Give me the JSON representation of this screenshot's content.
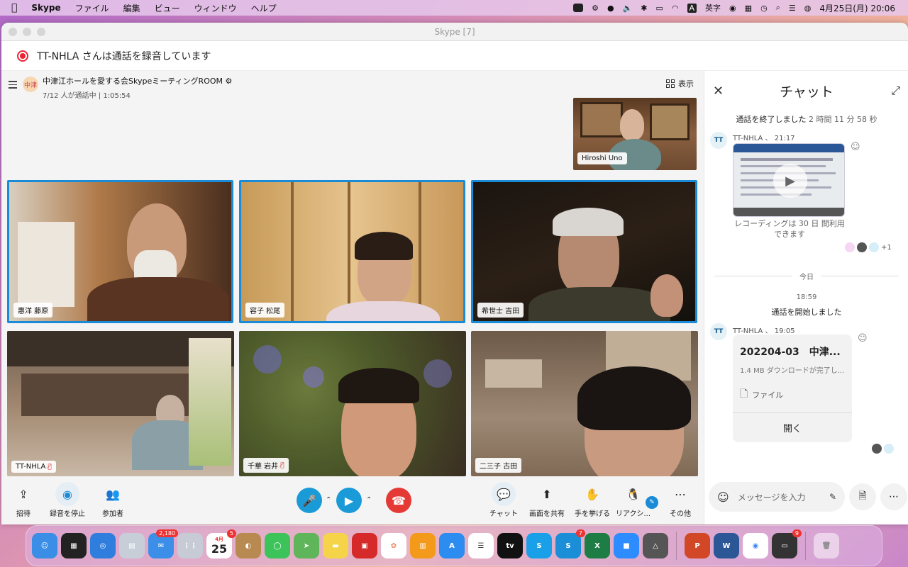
{
  "menubar": {
    "app_name": "Skype",
    "menus": [
      "ファイル",
      "編集",
      "ビュー",
      "ウィンドウ",
      "ヘルプ"
    ],
    "input_mode": "英字",
    "datetime": "4月25日(月)  20:06"
  },
  "window": {
    "title": "Skype [7]",
    "recording_banner": "TT-NHLA さんは通話を録音しています"
  },
  "call": {
    "avatar_text": "中津",
    "title": "中津江ホールを愛する会SkypeミーティングROOM",
    "subtitle": "7/12 人が通話中 | 1:05:54",
    "view_label": "表示"
  },
  "participants": {
    "self": "Hiroshi Uno",
    "tiles": [
      "惠洋 藤原",
      "容子 松尾",
      "希世士 吉田",
      "TT-NHLA",
      "千華 岩井",
      "二三子 古田"
    ]
  },
  "controls": {
    "invite": "招待",
    "stop_recording": "録音を停止",
    "participants": "参加者",
    "chat": "チャット",
    "share_screen": "画面を共有",
    "raise_hand": "手を挙げる",
    "reactions": "リアクシ...",
    "more": "その他"
  },
  "chat": {
    "header": "チャット",
    "call_ended": "通話を終了しました",
    "call_ended_duration": "2 時間 11 分 58 秒",
    "msg1_meta": "TT-NHLA 、 21:17",
    "avatar_tt": "TT",
    "recording_note": "レコーディングは 30 日 間利用できます",
    "read_more": "+1",
    "today": "今日",
    "time_1859": "18:59",
    "call_started": "通話を開始しました",
    "msg2_meta": "TT-NHLA 、 19:05",
    "file_name": "202204-03　中津...",
    "file_status": "1.4 MB ダウンロードが完了し...",
    "file_type": "ファイル",
    "open": "開く",
    "input_placeholder": "メッセージを入力"
  },
  "dock": {
    "mail_badge": "2,180",
    "calendar_month": "4月",
    "calendar_day": "25",
    "calendar_badge": "5",
    "skype_badge": "7",
    "printer_badge": "9"
  }
}
